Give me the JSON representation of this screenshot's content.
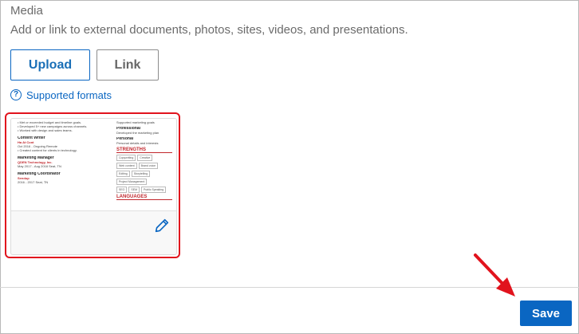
{
  "media": {
    "title": "Media",
    "description": "Add or link to external documents, photos, sites, videos, and presentations.",
    "upload_label": "Upload",
    "link_label": "Link",
    "supported_formats_label": "Supported formats",
    "help_icon": "question-circle-icon",
    "thumbnail": {
      "left_lines": [
        "• Met or exceeded budget and timeline goals.",
        "• Developed 5+ new campaigns across channels.",
        "• Worked with design and sales teams."
      ],
      "job1_title": "Content Writer",
      "job1_company": "Ha At Cont",
      "job1_meta": "Oct 2016 - Ongoing     Remote",
      "job1_desc": "• Created content for clients in technology.",
      "job2_title": "Marketing Manager",
      "job2_company": "QDEN Technology, Inc.",
      "job2_meta": "May 2017 - Aug 2018     Seat, TN",
      "job3_title": "Marketing Coordinator",
      "job3_company": "Sendup",
      "job3_meta": "2016 - 2017     Seat, TN",
      "right_top": "Supported marketing goals",
      "professional_label": "Professional",
      "professional_text": "Developed the marketing plan",
      "personal_label": "Personal",
      "personal_text": "Personal details and interests",
      "strengths_heading": "STRENGTHS",
      "strength_chips_1": [
        "Copywriting",
        "Creative"
      ],
      "strength_chips_2": [
        "Web content",
        "Brand voice"
      ],
      "strength_chips_3": [
        "Editing",
        "Storytelling"
      ],
      "strength_chips_4": [
        "Project Management"
      ],
      "strength_chips_5": [
        "SEO",
        "SEM",
        "Public Speaking"
      ],
      "languages_heading": "LANGUAGES"
    },
    "edit_icon": "pencil-icon"
  },
  "footer": {
    "save_label": "Save",
    "primary_color": "#0a66c2",
    "highlight_color": "#e1131d"
  }
}
